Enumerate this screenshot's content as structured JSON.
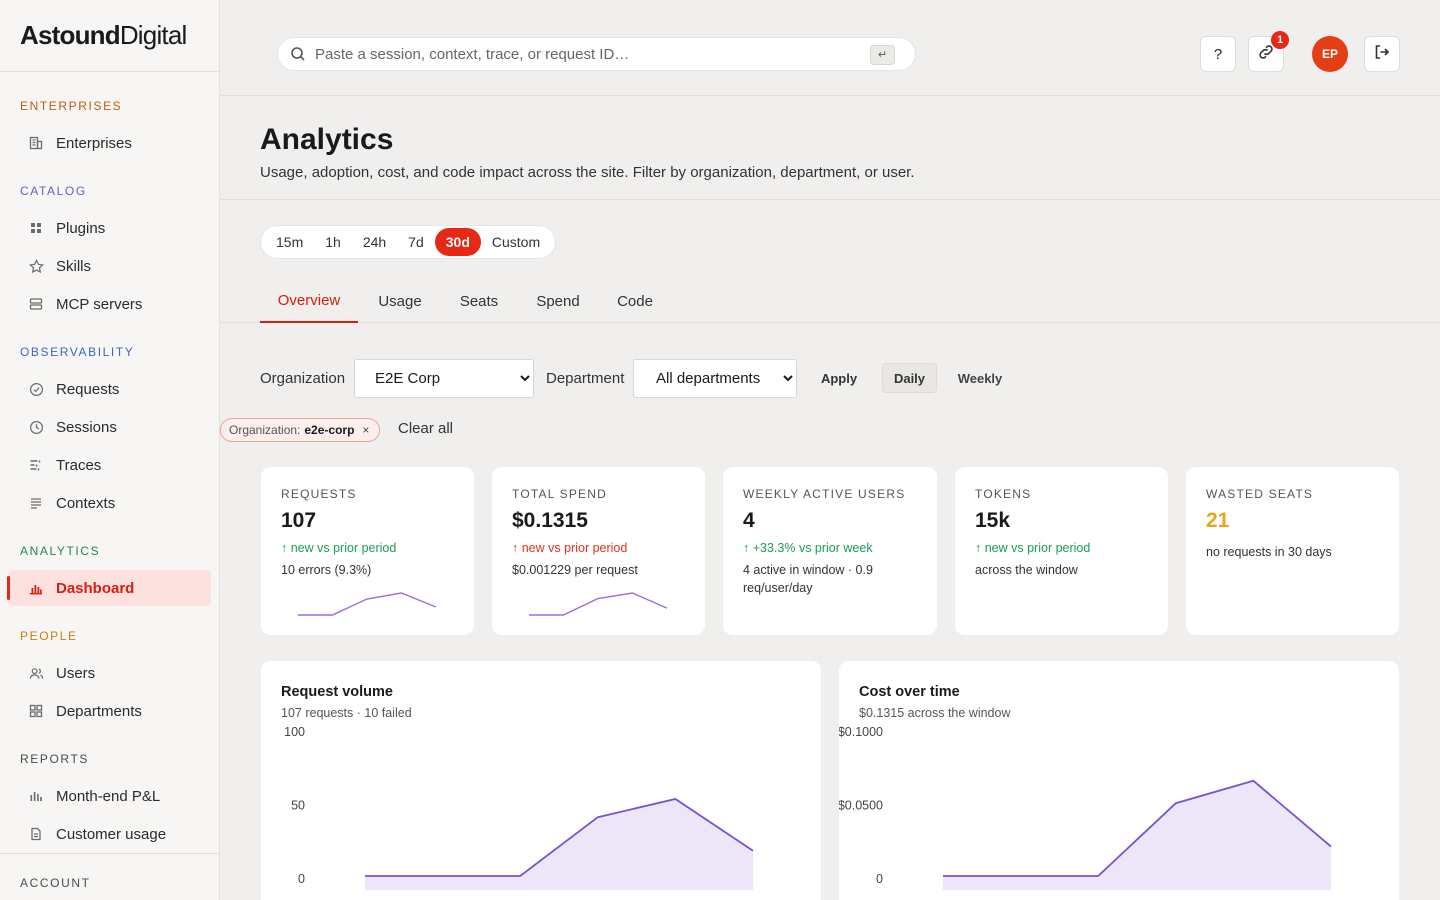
{
  "brand": {
    "logo_bold": "Astound",
    "logo_light": "Digital"
  },
  "sidebar": {
    "sections": [
      {
        "label": "ENTERPRISES",
        "color": "#c65a12"
      },
      {
        "label": "CATALOG",
        "color": "#6a5fc1"
      },
      {
        "label": "OBSERVABILITY",
        "color": "#3d69b8"
      },
      {
        "label": "ANALYTICS",
        "color": "#1a8a5a"
      },
      {
        "label": "PEOPLE",
        "color": "#c97d12"
      },
      {
        "label": "REPORTS",
        "color": "#4a4a4a"
      },
      {
        "label": "ACCOUNT",
        "color": "#4a4a4a"
      }
    ],
    "items": [
      {
        "label": "Enterprises",
        "icon": "building-icon"
      },
      {
        "label": "Plugins",
        "icon": "grid-icon"
      },
      {
        "label": "Skills",
        "icon": "star-icon"
      },
      {
        "label": "MCP servers",
        "icon": "server-icon"
      },
      {
        "label": "Requests",
        "icon": "check-circle-icon"
      },
      {
        "label": "Sessions",
        "icon": "clock-icon"
      },
      {
        "label": "Traces",
        "icon": "traces-icon"
      },
      {
        "label": "Contexts",
        "icon": "lines-icon"
      },
      {
        "label": "Dashboard",
        "icon": "bar-chart-icon",
        "active": true
      },
      {
        "label": "Users",
        "icon": "users-icon"
      },
      {
        "label": "Departments",
        "icon": "squares-icon"
      },
      {
        "label": "Month-end P&L",
        "icon": "bars-icon"
      },
      {
        "label": "Customer usage",
        "icon": "document-icon"
      }
    ]
  },
  "topbar": {
    "search_placeholder": "Paste a session, context, trace, or request ID…",
    "kbd_hint": "↵",
    "help_label": "?",
    "notification_count": "1",
    "avatar_initials": "EP"
  },
  "header": {
    "title": "Analytics",
    "subtitle": "Usage, adoption, cost, and code impact across the site. Filter by organization, department, or user."
  },
  "range": {
    "options": [
      "15m",
      "1h",
      "24h",
      "7d",
      "30d",
      "Custom"
    ],
    "selected": "30d"
  },
  "tabs": [
    "Overview",
    "Usage",
    "Seats",
    "Spend",
    "Code"
  ],
  "filters": {
    "org_label": "Organization",
    "org_value": "E2E Corp",
    "dept_label": "Department",
    "dept_value": "All departments",
    "apply": "Apply",
    "daily": "Daily",
    "weekly": "Weekly",
    "chip_key": "Organization:",
    "chip_value": "e2e-corp",
    "chip_remove": "×",
    "clear_all": "Clear all"
  },
  "kpis": [
    {
      "label": "REQUESTS",
      "value": "107",
      "delta": "↑ new vs prior period",
      "delta_tone": "green",
      "meta": "10 errors (9.3%)",
      "spark": [
        0,
        0,
        40,
        55,
        20
      ]
    },
    {
      "label": "TOTAL SPEND",
      "value": "$0.1315",
      "delta": "↑ new vs prior period",
      "delta_tone": "red",
      "meta": "$0.001229 per request",
      "spark": [
        0,
        0,
        0.048,
        0.064,
        0.02
      ]
    },
    {
      "label": "WEEKLY ACTIVE USERS",
      "value": "4",
      "delta": "↑ +33.3% vs prior week",
      "delta_tone": "green",
      "meta": "4 active in window · 0.9 req/user/day"
    },
    {
      "label": "TOKENS",
      "value": "15k",
      "delta": "↑ new vs prior period",
      "delta_tone": "green",
      "meta": "across the window"
    },
    {
      "label": "WASTED SEATS",
      "value": "21",
      "value_color": "#e6a817",
      "meta": "no requests in 30 days"
    }
  ],
  "chart_data": [
    {
      "type": "area",
      "title": "Request volume",
      "subtitle": "107 requests · 10 failed",
      "yticks": [
        "100",
        "50",
        "0"
      ],
      "ylim": [
        0,
        100
      ],
      "values": [
        0,
        0,
        0,
        42,
        55,
        18
      ],
      "color": "#7b4fd6",
      "grid": false
    },
    {
      "type": "area",
      "title": "Cost over time",
      "subtitle": "$0.1315 across the window",
      "yticks": [
        "$0.1000",
        "$0.0500",
        "0"
      ],
      "ylim": [
        0,
        0.1
      ],
      "values": [
        0,
        0,
        0,
        0.052,
        0.068,
        0.021
      ],
      "color": "#7b4fd6",
      "grid": false
    }
  ]
}
